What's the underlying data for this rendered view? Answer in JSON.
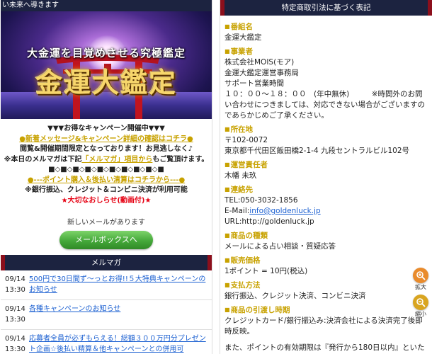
{
  "left": {
    "topbar_text": "い未来へ導きます",
    "banner": {
      "subtitle": "大金運を目覚めさせる究極鑑定",
      "title": "金運大鑑定"
    },
    "campaign": {
      "line1": "▼▼▼お得なキャンペーン開催中▼▼▼",
      "line2": "●新着メッセージ&キャンペーン詳細の確認はコチラ●",
      "line3": "閲覧&開催期間限定となっております！お見逃しなく♪",
      "line4_before": "※本日のメルマガは下記",
      "line4_highlight": "「メルマガ」項目から",
      "line4_after": "もご覧頂けます。",
      "line5": "■◇■◇■◇■◇■◇■◇■◇■◇■◇■",
      "line6": "●---ポイント購入＆後払い清算はコチラから---●",
      "line7": "※銀行振込、クレジット＆コンビニ決済が利用可能",
      "line8": "★大切なおしらせ(動画付)★"
    },
    "new_mail_text": "新しいメールがあります",
    "mailbox_button": "メールボックスへ",
    "section_title": "メルマガ",
    "news": [
      {
        "date": "09/14",
        "time": "13:30",
        "title": "500円で30日間ず〜っとお得!!５大特典キャンペーンのお知らせ"
      },
      {
        "date": "09/14",
        "time": "13:30",
        "title": "各種キャンペーンのお知らせ"
      },
      {
        "date": "09/14",
        "time": "13:30",
        "title": "応募者全員が必ずもらえる！総額３００万円分プレゼント企画☆後払い精算＆他キャンペーンとの併用可"
      }
    ]
  },
  "right": {
    "header_title": "特定商取引法に基づく表記",
    "items": [
      {
        "label": "番組名",
        "lines": [
          "金運大鑑定"
        ]
      },
      {
        "label": "事業者",
        "lines": [
          "株式会社MOIS(モア)",
          "金運大鑑定運営事務局",
          "サポート営業時間",
          "１０：００〜１８：００　(年中無休)　　　※時間外のお問い合わせにつきましては、対応できない場合がございますのであらかじめご了承ください。"
        ]
      },
      {
        "label": "所在地",
        "lines": [
          "〒102-0072",
          "東京都千代田区飯田橋2-1-4 九段セントラルビル102号"
        ]
      },
      {
        "label": "運営責任者",
        "lines": [
          "木幡 未玖"
        ]
      },
      {
        "label": "連絡先",
        "lines": [
          "TEL:050-3032-1856"
        ],
        "email_prefix": "E-Mail:",
        "email": "info@goldenluck.jp",
        "url_line": "URL:http://goldenluck.jp"
      },
      {
        "label": "商品の種類",
        "lines": [
          "メールによる占い相談・質疑応答"
        ]
      },
      {
        "label": "販売価格",
        "lines": [
          "1ポイント = 10円(税込)"
        ]
      },
      {
        "label": "支払方法",
        "lines": [
          "銀行振込、クレジット決済、コンビニ決済"
        ]
      },
      {
        "label": "商品の引渡し時期",
        "lines": [
          "クレジットカード/銀行振込み:決済会社による決済完了後即時反映。",
          "また、ポイントの有効期限は『発行から180日以内』といたします。"
        ]
      }
    ],
    "zoom_in_label": "拡大",
    "zoom_out_label": "縮小"
  },
  "colors": {
    "navy": "#1c2340",
    "crimson": "#8c0f1c",
    "gold": "#c8a200",
    "link_blue": "#1a5fd1",
    "red": "#e60012",
    "green_button": "#45a83a"
  }
}
